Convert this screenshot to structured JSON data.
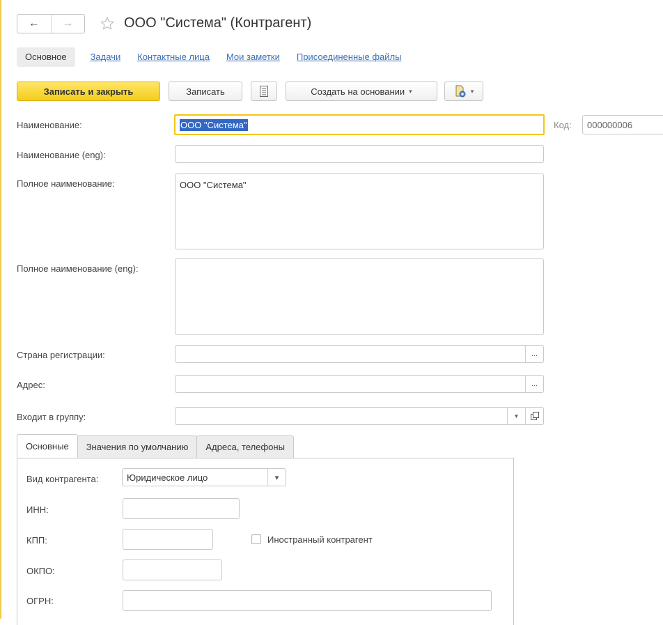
{
  "window": {
    "title": "ООО \"Система\" (Контрагент)",
    "back_icon": "←",
    "forward_icon": "→",
    "star_icon": "star-outline"
  },
  "sections": {
    "main": "Основное",
    "tasks": "Задачи",
    "contacts": "Контактные лица",
    "notes": "Мои заметки",
    "files": "Присоединенные файлы"
  },
  "toolbar": {
    "save_close": "Записать и закрыть",
    "save": "Записать",
    "create_based": "Создать на основании",
    "caret": "▾"
  },
  "form": {
    "name_label": "Наименование:",
    "name_value": "ООО \"Система\"",
    "code_label": "Код:",
    "code_value": "000000006",
    "name_eng_label": "Наименование (eng):",
    "name_eng_value": "",
    "full_name_label": "Полное наименование:",
    "full_name_value": "ООО \"Система\"",
    "full_name_eng_label": "Полное наименование (eng):",
    "full_name_eng_value": "",
    "country_label": "Страна регистрации:",
    "country_value": "",
    "address_label": "Адрес:",
    "address_value": "",
    "group_label": "Входит в группу:",
    "group_value": "",
    "ellipsis": "...",
    "dropdown": "▾"
  },
  "tabs": {
    "basic": "Основные",
    "defaults": "Значения по умолчанию",
    "addresses": "Адреса, телефоны"
  },
  "panel": {
    "kind_label": "Вид контрагента:",
    "kind_value": "Юридическое лицо",
    "inn_label": "ИНН:",
    "inn_value": "",
    "kpp_label": "КПП:",
    "kpp_value": "",
    "foreign_label": "Иностранный контрагент",
    "foreign_checked": false,
    "okpo_label": "ОКПО:",
    "okpo_value": "",
    "ogrn_label": "ОГРН:",
    "ogrn_value": ""
  },
  "colors": {
    "accent_yellow": "#f5cd1d",
    "link_blue": "#3a6fb5",
    "selection_blue": "#3367c4"
  }
}
